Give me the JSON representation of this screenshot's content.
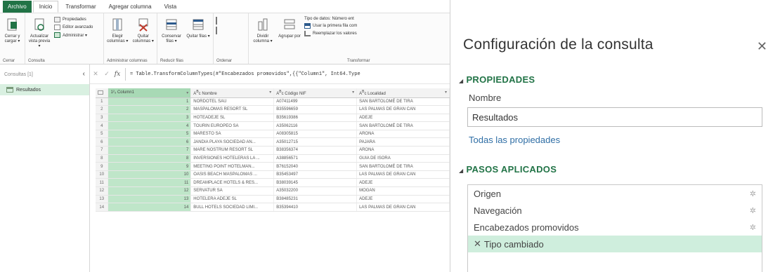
{
  "tabs": [
    "Archivo",
    "Inicio",
    "Transformar",
    "Agregar columna",
    "Vista"
  ],
  "ribbon": {
    "cerrar": {
      "btn": "Cerrar y cargar ▾",
      "label": "Cerrar"
    },
    "consulta": {
      "actualizar": "Actualizar vista previa ▾",
      "propiedades": "Propiedades",
      "editor": "Editor avanzado",
      "administrar": "Administrar ▾",
      "label": "Consulta"
    },
    "columnas": {
      "elegir": "Elegir columnas ▾",
      "quitar": "Quitar columnas ▾",
      "label": "Administrar columnas"
    },
    "filas": {
      "conservar": "Conservar filas ▾",
      "quitar": "Quitar filas ▾",
      "label": "Reducir filas"
    },
    "ordenar": {
      "label": "Ordenar"
    },
    "transformar": {
      "dividir": "Dividir columna ▾",
      "agrupar": "Agrupar por",
      "tipo": "Tipo de datos: Número ent",
      "primera": "Usar la primera fila com",
      "reemplazar": "Reemplazar los valores",
      "label": "Transformar"
    }
  },
  "left": {
    "header": "Consultas [1]",
    "item": "Resultados"
  },
  "formula": {
    "text": "= Table.TransformColumnTypes(#\"Encabezados promovidos\",{{\"Column1\", Int64.Type"
  },
  "grid": {
    "headers": [
      "Column1",
      "Nombre",
      "Código NIF",
      "Localidad"
    ],
    "rows": [
      [
        "1",
        "1",
        "NORDOTEL SAU",
        "A07411499",
        "SAN BARTOLOMÉ DE TIRA"
      ],
      [
        "2",
        "2",
        "MASPALOMAS RESORT SL",
        "B35596659",
        "LAS PALMAS DE GRAN CAN"
      ],
      [
        "3",
        "3",
        "HOTEADEJE SL",
        "B35619386",
        "ADEJE"
      ],
      [
        "4",
        "4",
        "TOURIN EUROPEO SA",
        "A35062116",
        "SAN BARTOLOMÉ DE TIRA"
      ],
      [
        "5",
        "5",
        "MARESTO SA",
        "A08305815",
        "ARONA"
      ],
      [
        "6",
        "6",
        "JANDIA PLAYA SOCIEDAD AN...",
        "A35012715",
        "PAJARA"
      ],
      [
        "7",
        "7",
        "MARE NOSTRUM RESORT SL",
        "B38356374",
        "ARONA"
      ],
      [
        "8",
        "8",
        "INVERSIONES HOTELERAS LA ...",
        "A38856571",
        "GUIA DE ISORA"
      ],
      [
        "9",
        "9",
        "MEETING POINT HOTELMAN...",
        "B76152040",
        "SAN BARTOLOMÉ DE TIRA"
      ],
      [
        "10",
        "10",
        "OASIS BEACH MASPALOMAS ...",
        "B35453497",
        "LAS PALMAS DE GRAN CAN"
      ],
      [
        "11",
        "11",
        "DREAMPLACE HOTELS & RES...",
        "B38039145",
        "ADEJE"
      ],
      [
        "12",
        "12",
        "SERVATUR SA",
        "A35032200",
        "MOGAN"
      ],
      [
        "13",
        "13",
        "HOTELERA ADEJE SL",
        "B38485231",
        "ADEJE"
      ],
      [
        "14",
        "14",
        "BULL HOTELS SOCIEDAD LIMI...",
        "B35394410",
        "LAS PALMAS DE GRAN CAN"
      ]
    ]
  },
  "right": {
    "title": "Configuración de la consulta",
    "close": "✕",
    "propiedades": "PROPIEDADES",
    "nombre_label": "Nombre",
    "nombre_value": "Resultados",
    "todas": "Todas las propiedades",
    "pasos": "PASOS APLICADOS",
    "steps": [
      "Origen",
      "Navegación",
      "Encabezados promovidos",
      "Tipo cambiado"
    ]
  }
}
